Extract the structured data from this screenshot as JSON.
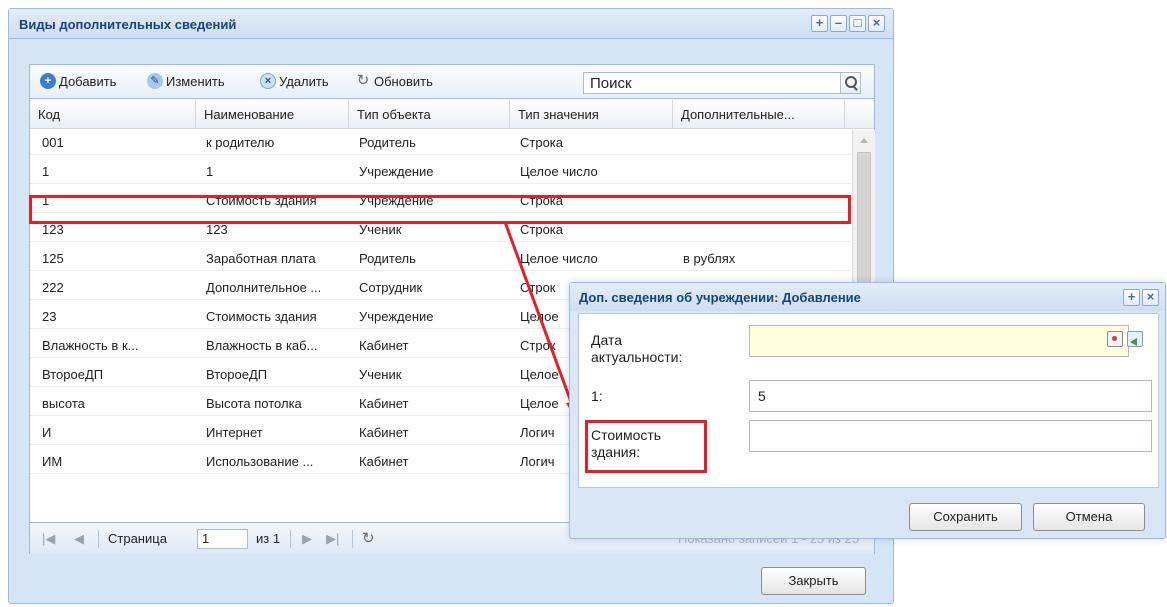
{
  "window": {
    "title": "Виды дополнительных сведений",
    "close_button": "Закрыть"
  },
  "toolbar": {
    "add": "Добавить",
    "edit": "Изменить",
    "delete": "Удалить",
    "refresh": "Обновить",
    "search_placeholder": "Поиск"
  },
  "grid": {
    "columns": [
      "Код",
      "Наименование",
      "Тип объекта",
      "Тип значения",
      "Дополнительные..."
    ],
    "rows": [
      [
        "001",
        "к родителю",
        "Родитель",
        "Строка",
        ""
      ],
      [
        "1",
        "1",
        "Учреждение",
        "Целое число",
        ""
      ],
      [
        "1",
        "Стоимость здания",
        "Учреждение",
        "Строка",
        ""
      ],
      [
        "123",
        "123",
        "Ученик",
        "Строка",
        ""
      ],
      [
        "125",
        "Заработная плата",
        "Родитель",
        "Целое число",
        "в рублях"
      ],
      [
        "222",
        "Дополнительное ...",
        "Сотрудник",
        "Строк",
        ""
      ],
      [
        "23",
        "Стоимость здания",
        "Учреждение",
        "Целое",
        ""
      ],
      [
        "Влажность в к...",
        "Влажность в каб...",
        "Кабинет",
        "Строк",
        ""
      ],
      [
        "ВтороеДП",
        "ВтороеДП",
        "Ученик",
        "Целое",
        ""
      ],
      [
        "высота",
        "Высота потолка",
        "Кабинет",
        "Целое",
        ""
      ],
      [
        "И",
        "Интернет",
        "Кабинет",
        "Логич",
        ""
      ],
      [
        "ИМ",
        "Использование ...",
        "Кабинет",
        "Логич",
        ""
      ]
    ]
  },
  "pager": {
    "page_label": "Страница",
    "page_value": "1",
    "of_label": "из 1",
    "shown": "Показано записей 1 - 25 из 25"
  },
  "dialog": {
    "title": "Доп. сведения об учреждении: Добавление",
    "date_label_line1": "Дата",
    "date_label_line2": "актуальности:",
    "field1_label": "1:",
    "field1_value": "5",
    "field2_label_line1": "Стоимость",
    "field2_label_line2": "здания:",
    "save": "Сохранить",
    "cancel": "Отмена"
  },
  "colors": {
    "highlight": "#e2202a",
    "title_text": "#15428b"
  }
}
